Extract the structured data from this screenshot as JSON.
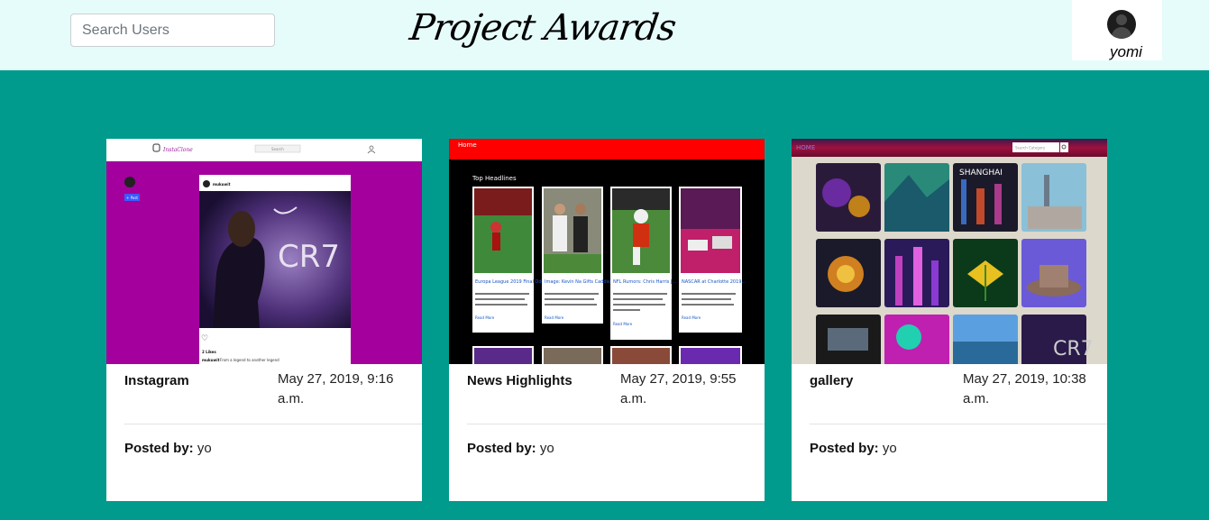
{
  "header": {
    "search_placeholder": "Search Users",
    "brand": "Project Awards",
    "username": "yomi"
  },
  "colors": {
    "background": "#009b8c",
    "navbar": "#e6fcfb"
  },
  "projects": [
    {
      "title": "Instagram",
      "date": "May 27, 2019, 9:16 a.m.",
      "posted_label": "Posted by:",
      "author": "yo",
      "preview": {
        "logo": "InstaClone",
        "search": "Search",
        "post_user": "mukuwit",
        "brand_text": "CR7",
        "likes": "2 Likes",
        "caption_user": "mukuwit",
        "caption": "From a legend to another legend",
        "follow_button": "+ Post"
      }
    },
    {
      "title": "News Highlights",
      "date": "May 27, 2019, 9:55 a.m.",
      "posted_label": "Posted by:",
      "author": "yo",
      "preview": {
        "nav_home": "Home",
        "section_heading": "Top Headlines",
        "read_more": "Read More",
        "headlines": [
          "Europa League 2019 Final Odds, ...",
          "Image: Kevin Na Gifts Caddie ...",
          "NFL Rumors: Chris Harris J...",
          "NASCAR at Charlotte 2019..."
        ]
      }
    },
    {
      "title": "gallery",
      "date": "May 27, 2019, 10:38 a.m.",
      "posted_label": "Posted by:",
      "author": "yo",
      "preview": {
        "nav_home": "HOME",
        "search_placeholder": "Search Category",
        "tile_label": "SHANGHAI",
        "tile_cr7": "CR7"
      }
    }
  ]
}
